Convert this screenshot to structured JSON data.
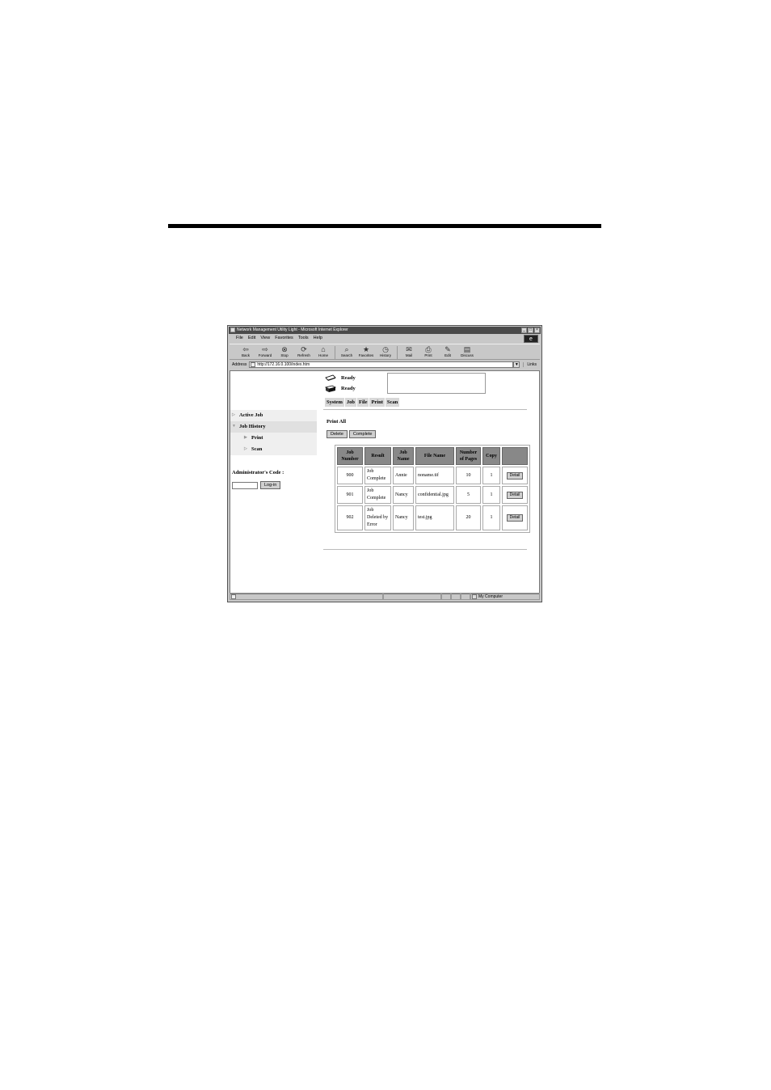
{
  "window": {
    "title": "Network Management Utility Light - Microsoft Internet Explorer",
    "controls": [
      "_",
      "□",
      "×"
    ]
  },
  "menu": [
    "File",
    "Edit",
    "View",
    "Favorites",
    "Tools",
    "Help"
  ],
  "toolbar": {
    "buttons": [
      {
        "label": "Back",
        "icon": "back-arrow-icon"
      },
      {
        "label": "Forward",
        "icon": "forward-arrow-icon"
      },
      {
        "label": "Stop",
        "icon": "stop-icon"
      },
      {
        "label": "Refresh",
        "icon": "refresh-icon"
      },
      {
        "label": "Home",
        "icon": "home-icon"
      },
      {
        "label": "Search",
        "icon": "search-icon"
      },
      {
        "label": "Favorites",
        "icon": "favorites-icon"
      },
      {
        "label": "History",
        "icon": "history-icon"
      },
      {
        "label": "Mail",
        "icon": "mail-icon"
      },
      {
        "label": "Print",
        "icon": "print-icon"
      },
      {
        "label": "Edit",
        "icon": "edit-icon"
      },
      {
        "label": "Discuss",
        "icon": "discuss-icon"
      }
    ]
  },
  "address": {
    "label": "Address",
    "url": "http://172.16.0.100/index.htm",
    "links": "Links"
  },
  "device_status": [
    {
      "status": "Ready",
      "icon": "printer-icon"
    },
    {
      "status": "Ready",
      "icon": "scanner-icon"
    }
  ],
  "tabs": [
    "System",
    "Job",
    "File",
    "Print",
    "Scan"
  ],
  "nav": {
    "active_job": "Active Job",
    "job_history": "Job History",
    "print": "Print",
    "scan": "Scan"
  },
  "admin": {
    "label": "Administrator's Code :",
    "login": "Log-in"
  },
  "main": {
    "title": "Print All",
    "delete": "Delete",
    "complete": "Complete",
    "columns": [
      "Job Number",
      "Result",
      "Job Name",
      "File Name",
      "Number of Pages",
      "Copy",
      ""
    ],
    "rows": [
      {
        "number": "900",
        "result": "Job Complete",
        "name": "Annie",
        "file": "noname.tif",
        "pages": "10",
        "copy": "1",
        "action": "Detail"
      },
      {
        "number": "901",
        "result": "Job Complete",
        "name": "Nancy",
        "file": "confidential.jpg",
        "pages": "5",
        "copy": "1",
        "action": "Detail"
      },
      {
        "number": "902",
        "result": "Job Deleted by Error",
        "name": "Nancy",
        "file": "test.jpg",
        "pages": "20",
        "copy": "1",
        "action": "Detail"
      }
    ]
  },
  "statusbar": {
    "zone": "My Computer"
  }
}
